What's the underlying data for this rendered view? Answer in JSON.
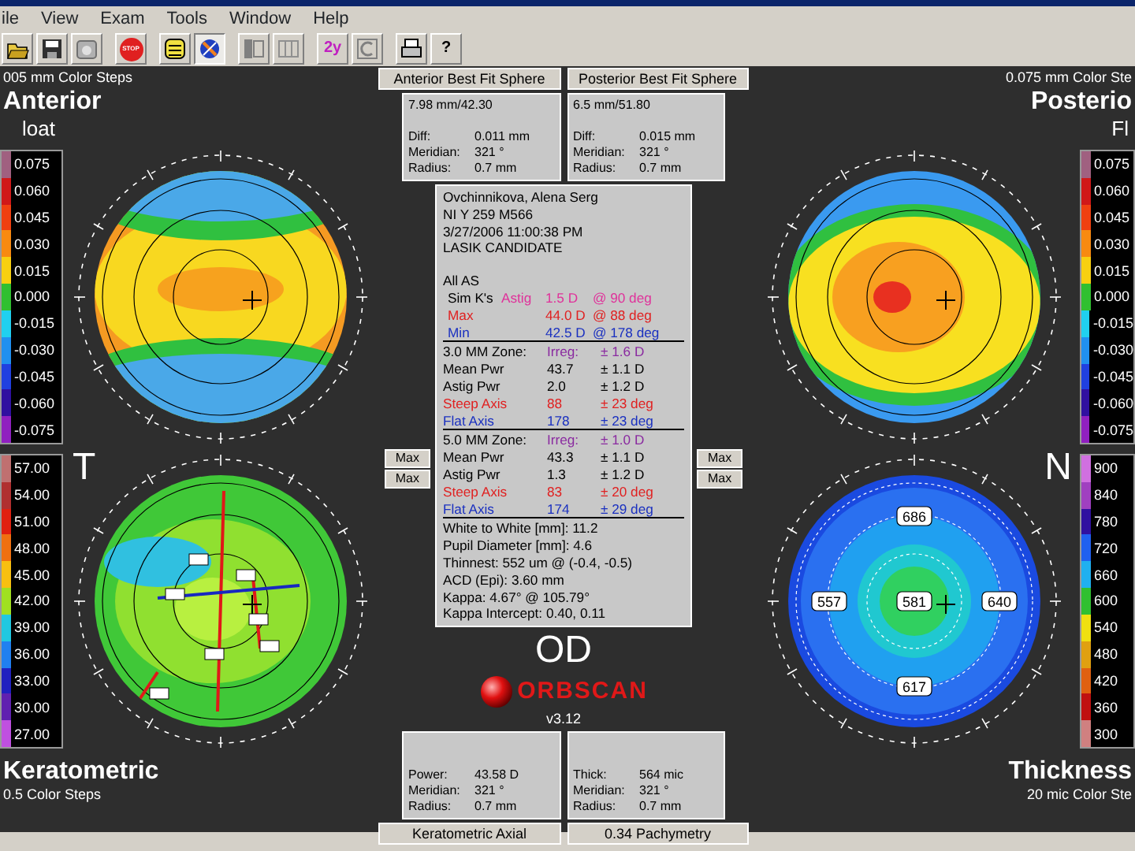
{
  "menu": [
    "ile",
    "View",
    "Exam",
    "Tools",
    "Window",
    "Help"
  ],
  "toolbar": [
    {
      "kind": "folder",
      "pressed": false
    },
    {
      "kind": "save",
      "pressed": false
    },
    {
      "kind": "disk",
      "pressed": false
    },
    {
      "kind": "stop",
      "label": "STOP",
      "pressed": false
    },
    {
      "kind": "list",
      "pressed": false
    },
    {
      "kind": "compass",
      "pressed": true
    },
    {
      "kind": "panel",
      "pressed": false
    },
    {
      "kind": "grid",
      "pressed": false
    },
    {
      "kind": "text",
      "label": "2y",
      "pressed": false
    },
    {
      "kind": "copy",
      "pressed": false
    },
    {
      "kind": "printer",
      "pressed": false
    },
    {
      "kind": "text",
      "label": "?",
      "pressed": false
    }
  ],
  "top_left": {
    "caption": "005 mm Color Steps",
    "title": "Anterior",
    "subtitle": "loat",
    "map": {
      "kind": "anterior"
    },
    "scale": [
      {
        "label": "0.075",
        "color": "#a06080"
      },
      {
        "label": "0.060",
        "color": "#d01818"
      },
      {
        "label": "0.045",
        "color": "#f04010"
      },
      {
        "label": "0.030",
        "color": "#f88a10"
      },
      {
        "label": "0.015",
        "color": "#f8d010"
      },
      {
        "label": "0.000",
        "color": "#30c030"
      },
      {
        "label": "-0.015",
        "color": "#20d0f0"
      },
      {
        "label": "-0.030",
        "color": "#2090f0"
      },
      {
        "label": "-0.045",
        "color": "#2040e0"
      },
      {
        "label": "-0.060",
        "color": "#3010a0"
      },
      {
        "label": "-0.075",
        "color": "#9020c0"
      }
    ]
  },
  "top_right": {
    "caption": "0.075 mm Color Ste",
    "title": "Posterio",
    "subtitle": "Fl",
    "map": {
      "kind": "posterior"
    },
    "scale": [
      {
        "label": "0.075",
        "color": "#a06080"
      },
      {
        "label": "0.060",
        "color": "#d01818"
      },
      {
        "label": "0.045",
        "color": "#f04010"
      },
      {
        "label": "0.030",
        "color": "#f88a10"
      },
      {
        "label": "0.015",
        "color": "#f8d010"
      },
      {
        "label": "0.000",
        "color": "#30c030"
      },
      {
        "label": "-0.015",
        "color": "#20d0f0"
      },
      {
        "label": "-0.030",
        "color": "#2090f0"
      },
      {
        "label": "-0.045",
        "color": "#2040e0"
      },
      {
        "label": "-0.060",
        "color": "#3010a0"
      },
      {
        "label": "-0.075",
        "color": "#9020c0"
      }
    ]
  },
  "bottom_left": {
    "side": "T",
    "title": "Keratometric",
    "caption": "0.5 Color Steps",
    "map": {
      "kind": "keratometric"
    },
    "scale": [
      {
        "label": "57.00",
        "color": "#c07070"
      },
      {
        "label": "54.00",
        "color": "#b03030"
      },
      {
        "label": "51.00",
        "color": "#e02010"
      },
      {
        "label": "48.00",
        "color": "#f07010"
      },
      {
        "label": "45.00",
        "color": "#f8c010"
      },
      {
        "label": "42.00",
        "color": "#a0e020"
      },
      {
        "label": "39.00",
        "color": "#20c8e0"
      },
      {
        "label": "36.00",
        "color": "#2080f0"
      },
      {
        "label": "33.00",
        "color": "#2020c0"
      },
      {
        "label": "30.00",
        "color": "#6020b0"
      },
      {
        "label": "27.00",
        "color": "#c050e0"
      }
    ]
  },
  "bottom_right": {
    "side": "N",
    "title": "Thickness",
    "caption": "20 mic Color Ste",
    "map": {
      "kind": "pachymetry",
      "readings": [
        {
          "kind": "top",
          "text": "686"
        },
        {
          "kind": "left",
          "text": "557"
        },
        {
          "kind": "center",
          "text": "581"
        },
        {
          "kind": "right",
          "text": "640"
        },
        {
          "kind": "bottom",
          "text": "617"
        }
      ]
    },
    "scale": [
      {
        "label": "900",
        "color": "#d070e0"
      },
      {
        "label": "840",
        "color": "#a040c0"
      },
      {
        "label": "780",
        "color": "#3010a0"
      },
      {
        "label": "720",
        "color": "#2060f0"
      },
      {
        "label": "660",
        "color": "#20b0f0"
      },
      {
        "label": "600",
        "color": "#30c030"
      },
      {
        "label": "540",
        "color": "#f0e010"
      },
      {
        "label": "480",
        "color": "#e0a010"
      },
      {
        "label": "420",
        "color": "#e06010"
      },
      {
        "label": "360",
        "color": "#c01010"
      },
      {
        "label": "300",
        "color": "#d08080"
      }
    ]
  },
  "sphere_headers": [
    "Anterior Best Fit Sphere",
    "Posterior Best Fit Sphere"
  ],
  "sphere_boxes": [
    {
      "head": "7.98 mm/42.30",
      "rows": [
        {
          "label": "Diff:",
          "value": "0.011 mm"
        },
        {
          "label": "Meridian:",
          "value": "321 °"
        },
        {
          "label": "Radius:",
          "value": "0.7 mm"
        }
      ]
    },
    {
      "head": "6.5 mm/51.80",
      "rows": [
        {
          "label": "Diff:",
          "value": "0.015 mm"
        },
        {
          "label": "Meridian:",
          "value": "321 °"
        },
        {
          "label": "Radius:",
          "value": "0.7 mm"
        }
      ]
    }
  ],
  "max_buttons": {
    "left": [
      "Max",
      "Max"
    ],
    "right": [
      "Max",
      "Max"
    ]
  },
  "patient": [
    "Ovchinnikova, Alena Serg",
    "NI Y 259 M566",
    "3/27/2006 11:00:38 PM",
    "LASIK CANDIDATE"
  ],
  "exam_label": "All AS",
  "simk": [
    {
      "kind": "head",
      "color": "#e0309a",
      "cells": [
        "Sim K's",
        "Astig",
        "1.5 D",
        "@ 90 deg"
      ]
    },
    {
      "kind": "full",
      "color": "#e02020",
      "cells": [
        "Max",
        "44.0 D",
        "@ 88 deg"
      ]
    },
    {
      "kind": "full",
      "color": "#1a30c0",
      "cells": [
        "Min",
        "42.5 D",
        "@ 178 deg"
      ]
    }
  ],
  "zones": [
    [
      {
        "kind": "head",
        "color": "#8a2aa0",
        "cells": [
          "3.0 MM Zone:",
          "Irreg:",
          "± 1.6 D"
        ]
      },
      {
        "kind": "plain",
        "cells": [
          "Mean Pwr",
          "43.7",
          "± 1.1 D"
        ]
      },
      {
        "kind": "plain",
        "cells": [
          "Astig Pwr",
          "2.0",
          "± 1.2 D"
        ]
      },
      {
        "kind": "full",
        "color": "#e02020",
        "cells": [
          "Steep Axis",
          "88",
          "± 23 deg"
        ]
      },
      {
        "kind": "full",
        "color": "#1a30c0",
        "cells": [
          "Flat Axis",
          "178",
          "± 23 deg"
        ]
      }
    ],
    [
      {
        "kind": "head",
        "color": "#8a2aa0",
        "cells": [
          "5.0 MM Zone:",
          "Irreg:",
          "± 1.0 D"
        ]
      },
      {
        "kind": "plain",
        "cells": [
          "Mean Pwr",
          "43.3",
          "± 1.1 D"
        ]
      },
      {
        "kind": "plain",
        "cells": [
          "Astig Pwr",
          "1.3",
          "± 1.2 D"
        ]
      },
      {
        "kind": "full",
        "color": "#e02020",
        "cells": [
          "Steep Axis",
          "83",
          "± 20 deg"
        ]
      },
      {
        "kind": "full",
        "color": "#1a30c0",
        "cells": [
          "Flat Axis",
          "174",
          "± 29 deg"
        ]
      }
    ]
  ],
  "measurements": [
    "White to White [mm]: 11.2",
    "Pupil Diameter [mm]: 4.6",
    "Thinnest: 552 um @ (-0.4, -0.5)",
    "ACD (Epi): 3.60 mm",
    "Kappa: 4.67° @ 105.79°",
    "Kappa Intercept: 0.40, 0.11"
  ],
  "eye": "OD",
  "logo": "ORBSCAN",
  "version": "v3.12",
  "point_boxes": [
    {
      "rows": [
        {
          "label": "Power:",
          "value": "43.58 D"
        },
        {
          "label": "Meridian:",
          "value": "321 °"
        },
        {
          "label": "Radius:",
          "value": "0.7 mm"
        }
      ]
    },
    {
      "rows": [
        {
          "label": "Thick:",
          "value": "564 mic"
        },
        {
          "label": "Meridian:",
          "value": "321 °"
        },
        {
          "label": "Radius:",
          "value": "0.7 mm"
        }
      ]
    }
  ],
  "footer_headers": [
    "Keratometric Axial",
    "0.34 Pachymetry"
  ]
}
